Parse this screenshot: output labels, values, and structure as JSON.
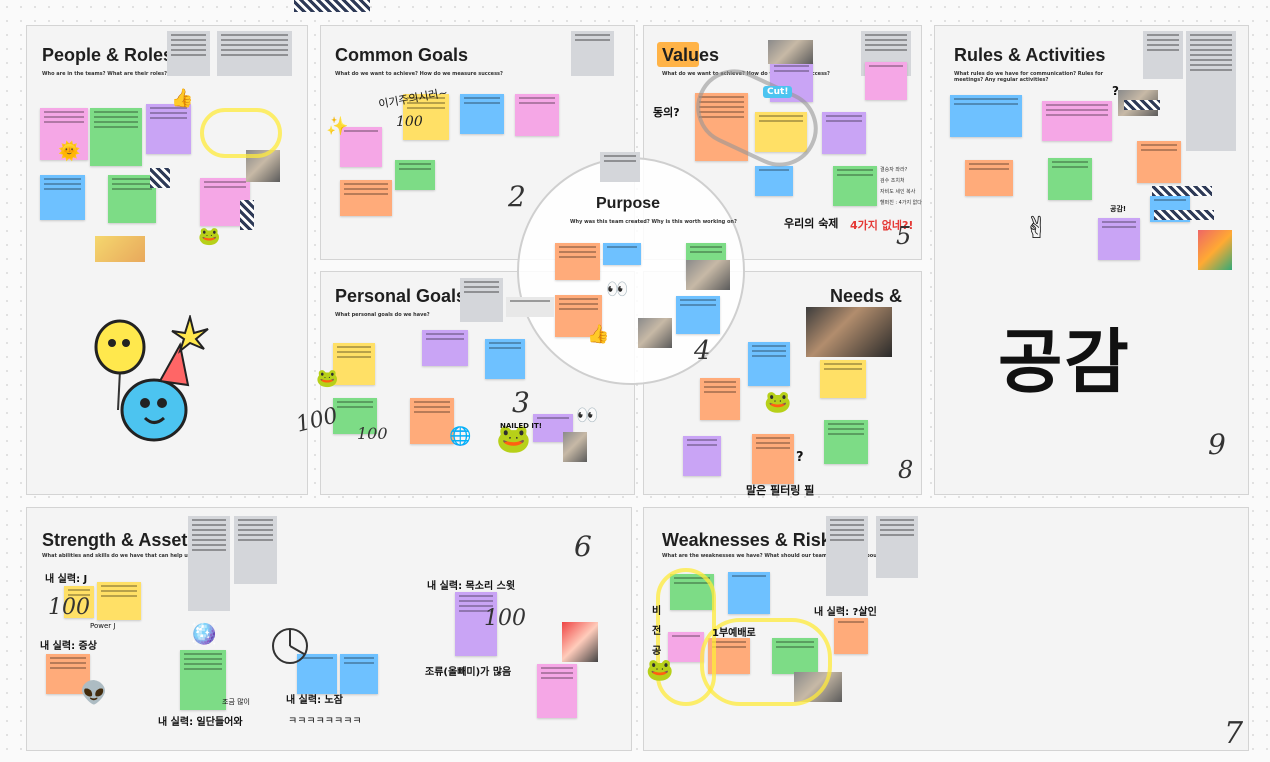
{
  "board": {
    "big_label": "공감"
  },
  "panels": {
    "people_roles": {
      "title": "People & Roles",
      "subtitle": "Who are in the teams? What are their roles?"
    },
    "common_goals": {
      "title": "Common Goals",
      "subtitle": "What do we want to achieve? How do we measure success?"
    },
    "values": {
      "title": "Values",
      "subtitle": "What do we want to achieve? How do we measure success?"
    },
    "rules": {
      "title": "Rules & Activities",
      "subtitle": "What rules do we have for communication? Rules for meetings? Any regular activities?"
    },
    "personal_goals": {
      "title": "Personal Goals",
      "subtitle": "What personal goals do we have?"
    },
    "needs": {
      "title": "Needs & Expectations",
      "title_visible": "Needs &"
    },
    "purpose": {
      "title": "Purpose",
      "subtitle": "Why was this team created? Why is this worth working on?"
    },
    "strength": {
      "title": "Strength & Assets",
      "subtitle": "What abilities and skills do we have that can help us?"
    },
    "weakness": {
      "title": "Weaknesses & Risks",
      "subtitle": "What are the weaknesses we have? What should our teammates know about us?"
    }
  },
  "annotations": {
    "egoist": "이기주의시러~",
    "agree": "동의?",
    "homework": "우리의 숙제",
    "four_missing": "4가지 없네?!",
    "filtering": "말은 필터링 필",
    "empathy_small": "공감!",
    "question": "?",
    "my_skill_j": "내 실력: J",
    "my_skill_symptom": "내 실력: 증상",
    "power_j": "Power J",
    "voice_sweet": "내 실력: 목소리 스윗",
    "many_jokes": "조류(올빼미)가 많음",
    "my_skill_old": "내 실력: 노잠",
    "kkk": "ㅋㅋㅋㅋㅋㅋㅋㅋ",
    "just_in": "내 실력: 일단들어와",
    "a_bit": "조금 많이",
    "dept": "1부예배로",
    "my_skill_age": "내 실력: ?살인",
    "side_vertical": "비전공",
    "cut": "Cut!",
    "hundred": "100",
    "nailed": "NAILED IT!",
    "right_notes": [
      "결승자 좌라?",
      "검수 조치처",
      "자비도 세인 복사",
      "헬퍼친 : 4가지 없다"
    ]
  },
  "doodles": {
    "n2": "2",
    "n3": "3",
    "n4": "4",
    "n5": "5",
    "n6": "6",
    "n7": "7",
    "n8": "8",
    "n9": "9"
  },
  "colors": {
    "yellow": "#ffe066",
    "pink": "#f5a7e6",
    "green": "#7ddc86",
    "blue": "#6ec1ff",
    "purple": "#c9a4f5",
    "orange": "#ffab7a",
    "note": "#d4d6da"
  }
}
